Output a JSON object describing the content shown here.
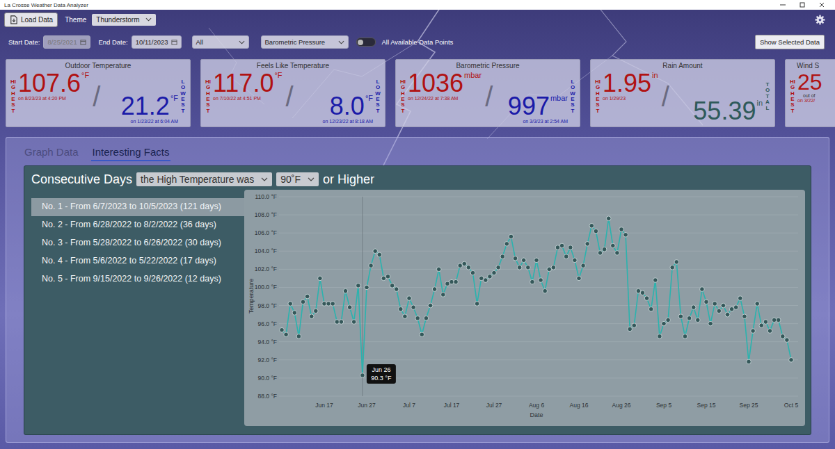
{
  "window": {
    "title": "La Crosse Weather Data Analyzer"
  },
  "toolbar": {
    "load_button": "Load Data",
    "theme_label": "Theme",
    "theme_value": "Thunderstorm"
  },
  "filters": {
    "start_date": {
      "label": "Start Date:",
      "value": "8/25/2021",
      "disabled": true
    },
    "end_date": {
      "label": "End Date:",
      "value": "10/11/2023",
      "disabled": false
    },
    "period_select": "All",
    "measure_select": "Barometric Pressure",
    "all_points_toggle": {
      "label": "All Available Data Points",
      "on": false
    },
    "show_button": "Show Selected Data"
  },
  "stat_cards": [
    {
      "kind": "full",
      "title": "Outdoor Temperature",
      "separator": "/",
      "high": {
        "label": "HIGHEST",
        "value": "107.6",
        "unit": "°F",
        "when": "on 8/23/23 at 4:20 PM"
      },
      "second": {
        "kind": "lowest",
        "label": "LOWEST",
        "value": "21.2",
        "unit": "°F",
        "when": "on 1/23/22 at 6:04 AM"
      }
    },
    {
      "kind": "full",
      "title": "Feels Like Temperature",
      "separator": "/",
      "high": {
        "label": "HIGHEST",
        "value": "117.0",
        "unit": "°F",
        "when": "on 7/10/22 at 4:51 PM"
      },
      "second": {
        "kind": "lowest",
        "label": "LOWEST",
        "value": "8.0",
        "unit": "°F",
        "when": "on 12/23/22 at 8:18 AM"
      }
    },
    {
      "kind": "full",
      "title": "Barometric Pressure",
      "separator": "/",
      "high": {
        "label": "HIGHEST",
        "value": "1036",
        "unit": "mbar",
        "when": "on 12/24/22 at 7:38 AM"
      },
      "second": {
        "kind": "lowest",
        "label": "LOWEST",
        "value": "997",
        "unit": "mbar",
        "when": "on 3/3/23 at 2:54 AM"
      }
    },
    {
      "kind": "full",
      "title": "Rain Amount",
      "separator": "/",
      "high": {
        "label": "HIGHEST",
        "value": "1.95",
        "unit": "in",
        "when": "on 1/29/23"
      },
      "second": {
        "kind": "total",
        "label": "TOTAL",
        "value": "55.39",
        "unit": "in"
      }
    },
    {
      "kind": "clipped",
      "title": "Wind S",
      "note": "out of",
      "high": {
        "label": "HIGHEST",
        "value": "25",
        "when": "on 3/22/"
      }
    }
  ],
  "tabs": [
    {
      "label": "Graph Data",
      "selected": false
    },
    {
      "label": "Interesting Facts",
      "selected": true
    }
  ],
  "facts": {
    "prefix": "Consecutive Days",
    "condition_select": "the High Temperature was",
    "threshold_select": "90˚F",
    "suffix": "or Higher",
    "streaks": [
      {
        "label": "No. 1 - From 6/7/2023 to 10/5/2023 (121 days)",
        "selected": true
      },
      {
        "label": "No. 2 - From 6/28/2022 to 8/2/2022 (36 days)",
        "selected": false
      },
      {
        "label": "No. 3 - From 5/28/2022 to 6/26/2022 (30 days)",
        "selected": false
      },
      {
        "label": "No. 4 - From 5/6/2022 to 5/22/2022 (17 days)",
        "selected": false
      },
      {
        "label": "No. 5 - From 9/15/2022 to 9/26/2022 (12 days)",
        "selected": false
      }
    ]
  },
  "chart": {
    "y_axis_title": "Temperature",
    "x_axis_title": "Date",
    "y_ticks": [
      "88.0 °F",
      "90.0 °F",
      "92.0 °F",
      "94.0 °F",
      "96.0 °F",
      "98.0 °F",
      "100.0 °F",
      "102.0 °F",
      "104.0 °F",
      "106.0 °F",
      "108.0 °F",
      "110.0 °F"
    ],
    "x_ticks": [
      "Jun 17",
      "Jun 27",
      "Jul 7",
      "Jul 17",
      "Jul 27",
      "Aug 6",
      "Aug 16",
      "Aug 26",
      "Sep 5",
      "Sep 15",
      "Sep 25",
      "Oct 5"
    ],
    "values": [
      95.3,
      94.8,
      98.2,
      97.2,
      94.6,
      98.4,
      99.0,
      96.8,
      97.4,
      101.0,
      98.2,
      98.2,
      98.2,
      96.2,
      96.2,
      99.6,
      97.8,
      96.2,
      100.2,
      90.3,
      100.0,
      102.4,
      104.0,
      103.6,
      101.0,
      101.2,
      100.2,
      99.8,
      97.6,
      96.8,
      98.8,
      97.8,
      96.6,
      94.8,
      96.6,
      98.0,
      99.8,
      102.0,
      99.2,
      100.4,
      100.6,
      100.6,
      102.4,
      102.6,
      102.2,
      101.6,
      98.2,
      101.0,
      100.8,
      101.2,
      101.6,
      102.2,
      103.4,
      104.8,
      105.6,
      103.2,
      102.2,
      103.0,
      102.2,
      100.6,
      103.0,
      100.8,
      99.6,
      102.0,
      102.2,
      104.4,
      104.6,
      103.4,
      104.4,
      103.0,
      101.0,
      102.4,
      104.8,
      106.8,
      106.2,
      103.8,
      104.2,
      107.6,
      104.6,
      103.8,
      106.4,
      105.8,
      95.4,
      95.8,
      99.6,
      99.4,
      98.8,
      97.6,
      100.8,
      94.6,
      96.0,
      96.4,
      102.2,
      102.8,
      96.8,
      94.6,
      96.6,
      97.8,
      96.4,
      99.8,
      98.4,
      96.0,
      98.2,
      97.4,
      98.0,
      97.0,
      97.6,
      97.8,
      98.8,
      96.8,
      91.8,
      95.2,
      98.2,
      95.8,
      96.2,
      95.2,
      96.4,
      96.4,
      94.6,
      94.2,
      92.0
    ],
    "tooltip": {
      "point_index": 19,
      "date": "Jun 26",
      "value": "90.3 °F"
    }
  }
}
